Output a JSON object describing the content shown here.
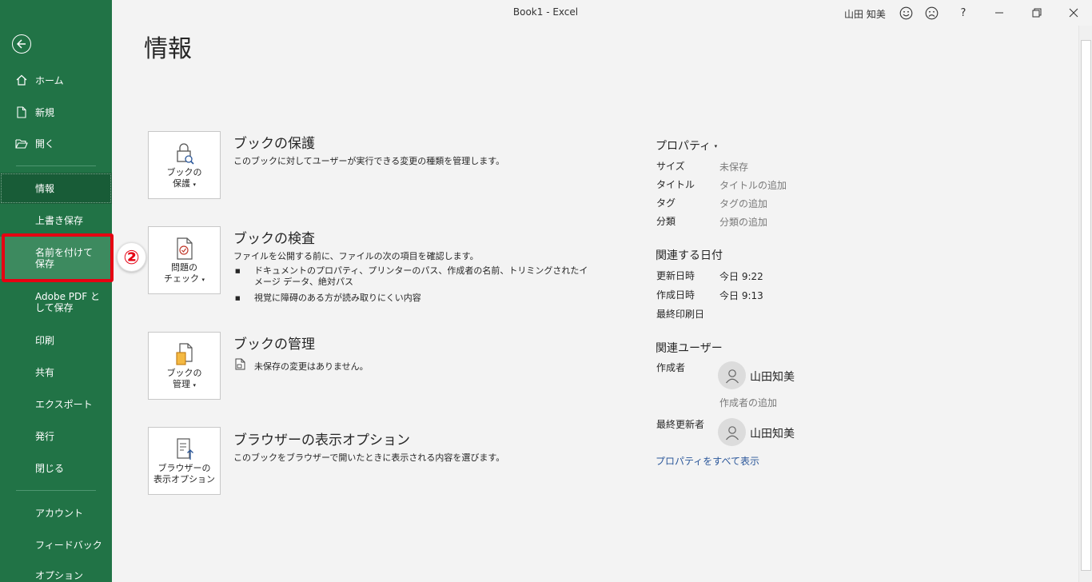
{
  "window": {
    "title": "Book1  -  Excel",
    "user": "山田 知美",
    "help": "?"
  },
  "sidebar": {
    "items": [
      {
        "id": "home",
        "label": "ホーム"
      },
      {
        "id": "new",
        "label": "新規"
      },
      {
        "id": "open",
        "label": "開く"
      },
      {
        "id": "info",
        "label": "情報"
      },
      {
        "id": "save",
        "label": "上書き保存"
      },
      {
        "id": "save-as",
        "label": "名前を付けて保存"
      },
      {
        "id": "adobe-pdf",
        "label": "Adobe PDF として保存"
      },
      {
        "id": "print",
        "label": "印刷"
      },
      {
        "id": "share",
        "label": "共有"
      },
      {
        "id": "export",
        "label": "エクスポート"
      },
      {
        "id": "publish",
        "label": "発行"
      },
      {
        "id": "close",
        "label": "閉じる"
      },
      {
        "id": "account",
        "label": "アカウント"
      },
      {
        "id": "feedback",
        "label": "フィードバック"
      },
      {
        "id": "options",
        "label": "オプション"
      }
    ],
    "annotation_badge": "②"
  },
  "main": {
    "title": "情報",
    "sections": [
      {
        "button_line1": "ブックの",
        "button_line2": "保護",
        "title": "ブックの保護",
        "description": "このブックに対してユーザーが実行できる変更の種類を管理します。"
      },
      {
        "button_line1": "問題の",
        "button_line2": "チェック",
        "title": "ブックの検査",
        "description": "ファイルを公開する前に、ファイルの次の項目を確認します。",
        "bullets": [
          "ドキュメントのプロパティ、プリンターのパス、作成者の名前、トリミングされたイメージ データ、絶対パス",
          "視覚に障碍のある方が読み取りにくい内容"
        ]
      },
      {
        "button_line1": "ブックの",
        "button_line2": "管理",
        "title": "ブックの管理",
        "description": "未保存の変更はありません。"
      },
      {
        "button_line1": "ブラウザーの",
        "button_line2": "表示オプション",
        "title": "ブラウザーの表示オプション",
        "description": "このブックをブラウザーで開いたときに表示される内容を選びます。"
      }
    ]
  },
  "properties": {
    "header": "プロパティ",
    "items": [
      {
        "key": "サイズ",
        "value": "未保存"
      },
      {
        "key": "タイトル",
        "value": "タイトルの追加"
      },
      {
        "key": "タグ",
        "value": "タグの追加"
      },
      {
        "key": "分類",
        "value": "分類の追加"
      }
    ],
    "dates_header": "関連する日付",
    "dates": [
      {
        "key": "更新日時",
        "value": "今日 9:22"
      },
      {
        "key": "作成日時",
        "value": "今日 9:13"
      },
      {
        "key": "最終印刷日",
        "value": ""
      }
    ],
    "people_header": "関連ユーザー",
    "author_label": "作成者",
    "author_name": "山田知美",
    "add_author": "作成者の追加",
    "last_modified_label": "最終更新者",
    "last_modified_name": "山田知美",
    "show_all": "プロパティをすべて表示"
  }
}
